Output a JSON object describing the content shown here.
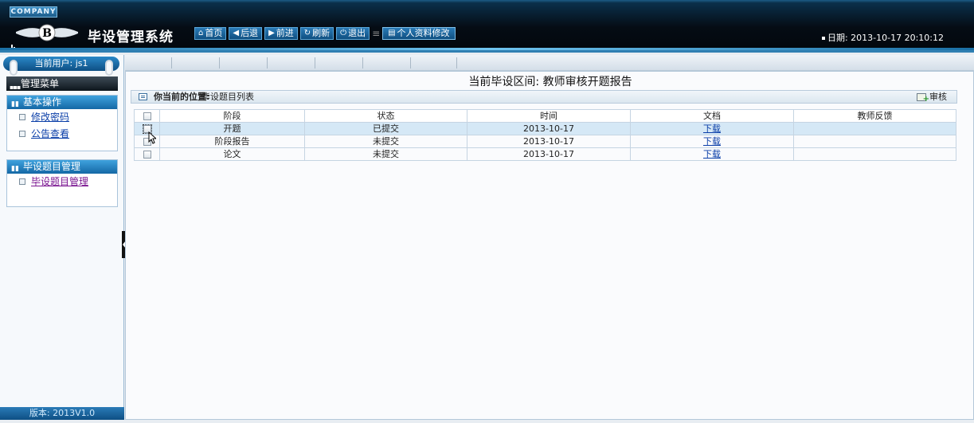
{
  "header": {
    "company_badge": "COMPANY",
    "title": "毕设管理系统",
    "toolbar": [
      {
        "icon": "home-icon",
        "glyph": "⌂",
        "label": "首页"
      },
      {
        "icon": "arrow-left-icon",
        "glyph": "◀",
        "label": "后退"
      },
      {
        "icon": "arrow-right-icon",
        "glyph": "▶",
        "label": "前进"
      },
      {
        "icon": "refresh-icon",
        "glyph": "↻",
        "label": "刷新"
      },
      {
        "icon": "power-icon",
        "glyph": "⏻",
        "label": "退出"
      }
    ],
    "profile_button": {
      "icon": "document-icon",
      "glyph": "▤",
      "label": "个人资料修改"
    },
    "date_label": "日期:",
    "date_value": "2013-10-17 20:10:12"
  },
  "sidebar": {
    "current_user_label": "当前用户: js1",
    "menu_title": "管理菜单",
    "groups": [
      {
        "title": "基本操作",
        "items": [
          "修改密码",
          "公告查看"
        ]
      },
      {
        "title": "毕设题目管理",
        "items": [
          "毕设题目管理"
        ]
      }
    ],
    "version": "版本: 2013V1.0"
  },
  "main": {
    "period_title": "当前毕设区间: 教师审核开题报告",
    "breadcrumb_label": "你当前的位置:",
    "breadcrumb_value": "毕设题目列表",
    "audit_button": "审核",
    "table": {
      "columns": [
        "阶段",
        "状态",
        "时间",
        "文档",
        "教师反馈"
      ],
      "rows": [
        {
          "stage": "开题",
          "status": "已提交",
          "time": "2013-10-17",
          "doc": "下载",
          "feedback": "",
          "highlight": true
        },
        {
          "stage": "阶段报告",
          "status": "未提交",
          "time": "2013-10-17",
          "doc": "下载",
          "feedback": "",
          "highlight": false
        },
        {
          "stage": "论文",
          "status": "未提交",
          "time": "2013-10-17",
          "doc": "下载",
          "feedback": "",
          "highlight": false
        }
      ]
    }
  }
}
